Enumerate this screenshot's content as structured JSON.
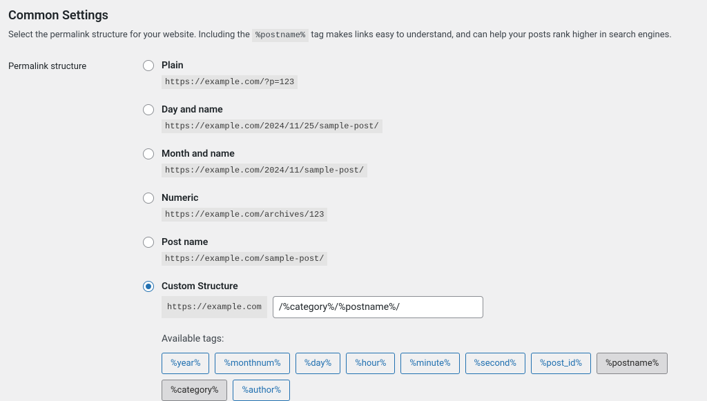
{
  "heading": "Common Settings",
  "intro": {
    "pre": "Select the permalink structure for your website. Including the ",
    "code": "%postname%",
    "post": " tag makes links easy to understand, and can help your posts rank higher in search engines."
  },
  "field_label": "Permalink structure",
  "options": {
    "plain": {
      "label": "Plain",
      "example": "https://example.com/?p=123"
    },
    "day": {
      "label": "Day and name",
      "example": "https://example.com/2024/11/25/sample-post/"
    },
    "month": {
      "label": "Month and name",
      "example": "https://example.com/2024/11/sample-post/"
    },
    "numeric": {
      "label": "Numeric",
      "example": "https://example.com/archives/123"
    },
    "postname": {
      "label": "Post name",
      "example": "https://example.com/sample-post/"
    },
    "custom": {
      "label": "Custom Structure",
      "prefix": "https://example.com",
      "value": "/%category%/%postname%/"
    }
  },
  "selected": "custom",
  "available_tags_label": "Available tags:",
  "tags": [
    {
      "text": "%year%",
      "active": false
    },
    {
      "text": "%monthnum%",
      "active": false
    },
    {
      "text": "%day%",
      "active": false
    },
    {
      "text": "%hour%",
      "active": false
    },
    {
      "text": "%minute%",
      "active": false
    },
    {
      "text": "%second%",
      "active": false
    },
    {
      "text": "%post_id%",
      "active": false
    },
    {
      "text": "%postname%",
      "active": true
    },
    {
      "text": "%category%",
      "active": true
    },
    {
      "text": "%author%",
      "active": false
    }
  ]
}
